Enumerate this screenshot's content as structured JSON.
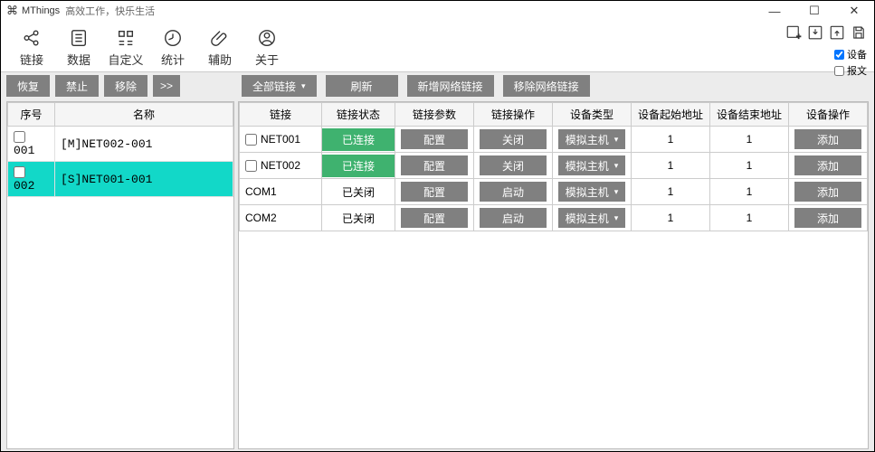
{
  "title": {
    "app": "MThings",
    "slogan": "高效工作，快乐生活"
  },
  "toolbar": [
    {
      "label": "链接"
    },
    {
      "label": "数据"
    },
    {
      "label": "自定义"
    },
    {
      "label": "统计"
    },
    {
      "label": "辅助"
    },
    {
      "label": "关于"
    }
  ],
  "rightChecks": {
    "device": "设备",
    "packet": "报文"
  },
  "left": {
    "buttons": {
      "restore": "恢复",
      "forbid": "禁止",
      "remove": "移除",
      "next": ">>"
    },
    "headers": {
      "seq": "序号",
      "name": "名称"
    },
    "rows": [
      {
        "seq": "001",
        "name": "[M]NET002-001",
        "selected": false
      },
      {
        "seq": "002",
        "name": "[S]NET001-001",
        "selected": true
      }
    ]
  },
  "right": {
    "buttons": {
      "all": "全部链接",
      "refresh": "刷新",
      "add": "新增网络链接",
      "remove": "移除网络链接"
    },
    "headers": {
      "link": "链接",
      "status": "链接状态",
      "param": "链接参数",
      "op": "链接操作",
      "type": "设备类型",
      "start": "设备起始地址",
      "end": "设备结束地址",
      "devop": "设备操作"
    },
    "labels": {
      "config": "配置",
      "close": "关闭",
      "start": "启动",
      "simhost": "模拟主机",
      "add": "添加"
    },
    "rows": [
      {
        "link": "NET001",
        "status": "已连接",
        "connected": true,
        "op": "关闭",
        "start": "1",
        "end": "1",
        "checkbox": true
      },
      {
        "link": "NET002",
        "status": "已连接",
        "connected": true,
        "op": "关闭",
        "start": "1",
        "end": "1",
        "checkbox": true
      },
      {
        "link": "COM1",
        "status": "已关闭",
        "connected": false,
        "op": "启动",
        "start": "1",
        "end": "1",
        "checkbox": false
      },
      {
        "link": "COM2",
        "status": "已关闭",
        "connected": false,
        "op": "启动",
        "start": "1",
        "end": "1",
        "checkbox": false
      }
    ]
  }
}
